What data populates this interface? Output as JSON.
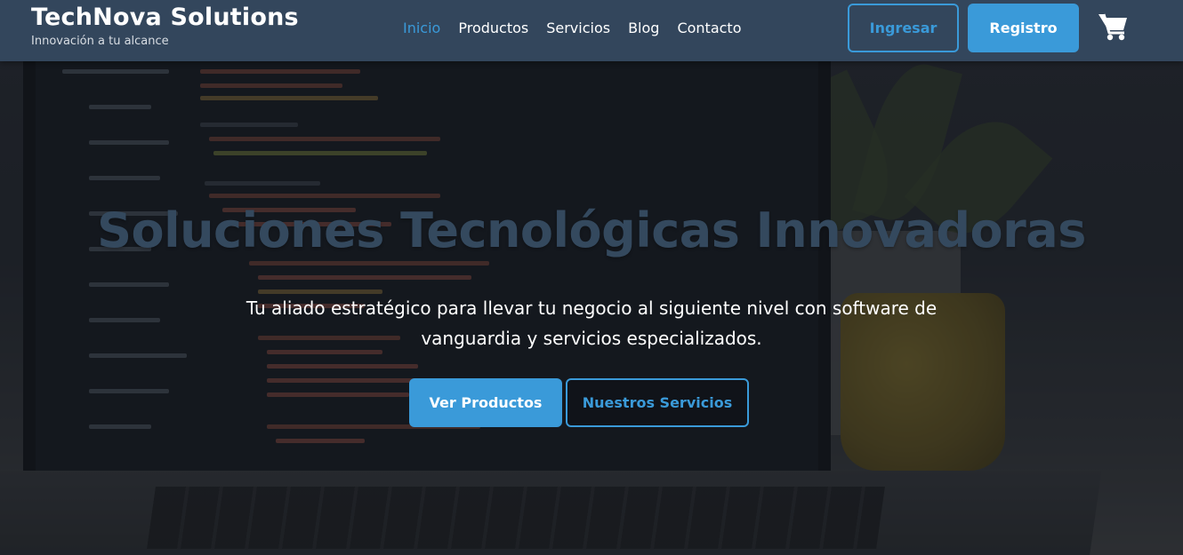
{
  "brand": {
    "name": "TechNova Solutions",
    "tagline": "Innovación a tu alcance"
  },
  "nav": {
    "items": [
      {
        "label": "Inicio",
        "active": true
      },
      {
        "label": "Productos",
        "active": false
      },
      {
        "label": "Servicios",
        "active": false
      },
      {
        "label": "Blog",
        "active": false
      },
      {
        "label": "Contacto",
        "active": false
      }
    ]
  },
  "auth": {
    "login_label": "Ingresar",
    "register_label": "Registro"
  },
  "cart": {
    "icon": "cart-icon"
  },
  "hero": {
    "title": "Soluciones Tecnológicas Innovadoras",
    "subtitle": "Tu aliado estratégico para llevar tu negocio al siguiente nivel con software de vanguardia y servicios especializados.",
    "primary_cta": "Ver Productos",
    "secondary_cta": "Nuestros Servicios"
  },
  "colors": {
    "accent": "#3a9ad9",
    "navbar": "#33465c",
    "title": "#34495e"
  }
}
